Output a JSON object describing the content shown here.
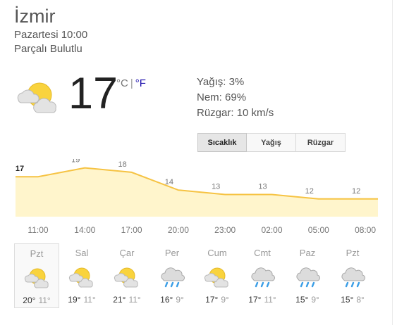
{
  "header": {
    "city": "İzmir",
    "datetime": "Pazartesi 10:00",
    "condition": "Parçalı Bulutlu"
  },
  "current": {
    "temp": "17",
    "unit_c": "°C",
    "separator": "|",
    "unit_f": "°F",
    "icon": "partly-cloudy-icon"
  },
  "details": {
    "precip": "Yağış: 3%",
    "humidity": "Nem: 69%",
    "wind": "Rüzgar: 10 km/s"
  },
  "tabs": [
    {
      "label": "Sıcaklık",
      "active": true
    },
    {
      "label": "Yağış",
      "active": false
    },
    {
      "label": "Rüzgar",
      "active": false
    }
  ],
  "colors": {
    "line": "#f6c343",
    "fill": "#fff5cc",
    "sun": "#f9d33d",
    "cloud": "#e3e3e3",
    "rain": "#3b9ee6"
  },
  "chart_data": {
    "type": "area",
    "x": [
      "11:00",
      "14:00",
      "17:00",
      "20:00",
      "23:00",
      "02:00",
      "05:00",
      "08:00"
    ],
    "values": [
      17,
      19,
      18,
      14,
      13,
      13,
      12,
      12
    ],
    "ylim": [
      8,
      21
    ],
    "grid": false,
    "legend": "none"
  },
  "days": [
    {
      "name": "Pzt",
      "hi": "20°",
      "lo": "11°",
      "icon": "partly-cloudy-icon",
      "selected": true
    },
    {
      "name": "Sal",
      "hi": "19°",
      "lo": "11°",
      "icon": "partly-cloudy-icon",
      "selected": false
    },
    {
      "name": "Çar",
      "hi": "21°",
      "lo": "11°",
      "icon": "partly-cloudy-icon",
      "selected": false
    },
    {
      "name": "Per",
      "hi": "16°",
      "lo": "9°",
      "icon": "rain-icon",
      "selected": false
    },
    {
      "name": "Cum",
      "hi": "17°",
      "lo": "9°",
      "icon": "partly-cloudy-icon",
      "selected": false
    },
    {
      "name": "Cmt",
      "hi": "17°",
      "lo": "11°",
      "icon": "rain-icon",
      "selected": false
    },
    {
      "name": "Paz",
      "hi": "15°",
      "lo": "9°",
      "icon": "rain-icon",
      "selected": false
    },
    {
      "name": "Pzt",
      "hi": "15°",
      "lo": "8°",
      "icon": "rain-icon",
      "selected": false
    }
  ]
}
